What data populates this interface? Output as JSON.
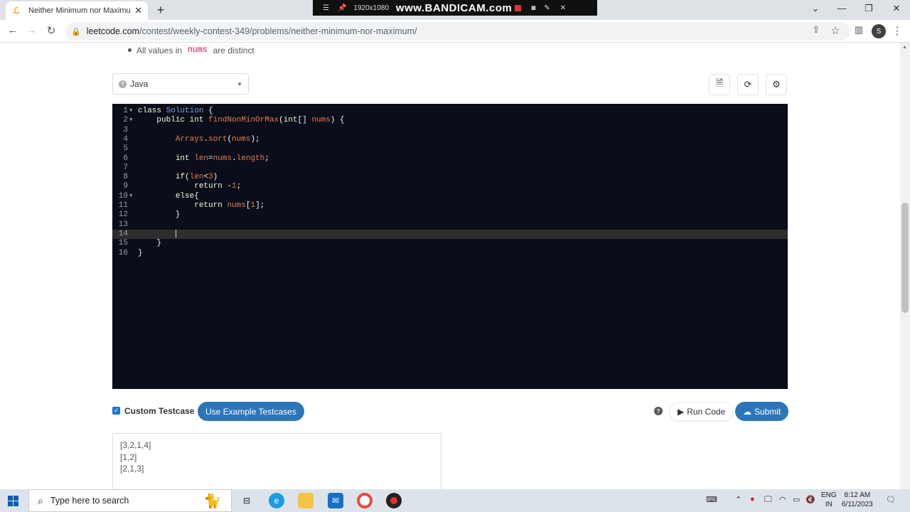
{
  "browser": {
    "tab_title": "Neither Minimum nor Maximum",
    "url_host": "leetcode.com",
    "url_path": "/contest/weekly-contest-349/problems/neither-minimum-nor-maximum/",
    "profile_initial": "S"
  },
  "recorder": {
    "resolution": "1920x1080",
    "brand": "www.BANDICAM.com"
  },
  "problem": {
    "bullet_prefix": "All values in",
    "bullet_code": "nums",
    "bullet_suffix": "are distinct"
  },
  "editor": {
    "language": "Java",
    "active_line": 14
  },
  "testcase": {
    "custom_label": "Custom Testcase",
    "use_example_label": "Use Example Testcases",
    "run_label": "Run Code",
    "submit_label": "Submit",
    "inputs": [
      "[3,2,1,4]",
      "[1,2]",
      "[2,1,3]"
    ]
  },
  "taskbar": {
    "search_placeholder": "Type here to search",
    "lang_top": "ENG",
    "lang_bottom": "IN",
    "time": "8:12 AM",
    "date": "6/11/2023"
  }
}
